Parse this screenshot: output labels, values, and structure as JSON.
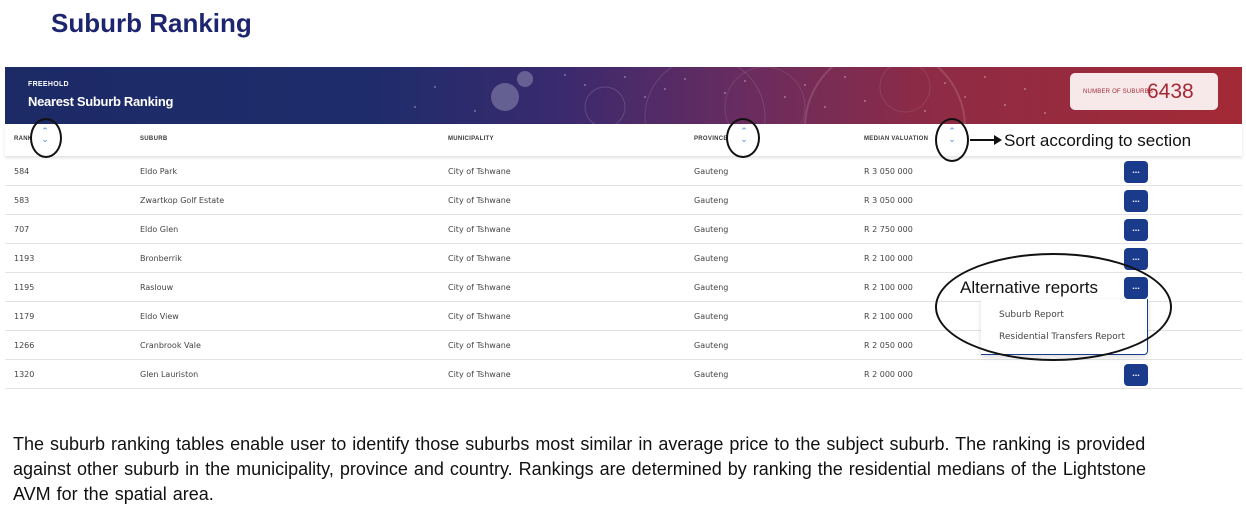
{
  "slide": {
    "title": "Suburb Ranking",
    "description": "The suburb ranking tables enable user to identify those suburbs most similar in average price to the subject suburb. The ranking is provided against other suburb in the municipality, province and country. Rankings are determined by ranking the residential medians of the Lightstone AVM for the spatial area."
  },
  "banner": {
    "subtitle": "FREEHOLD",
    "title": "Nearest Suburb Ranking",
    "count_label": "NUMBER OF SUBURBS",
    "count_value": "6438"
  },
  "columns": {
    "rank": "RANK",
    "suburb": "SUBURB",
    "municipality": "MUNICIPALITY",
    "province": "PROVINCE",
    "median": "MEDIAN VALUATION"
  },
  "rows": [
    {
      "rank": "584",
      "suburb": "Eldo Park",
      "municipality": "City of Tshwane",
      "province": "Gauteng",
      "median": "R 3 050 000",
      "action": "..."
    },
    {
      "rank": "583",
      "suburb": "Zwartkop Golf Estate",
      "municipality": "City of Tshwane",
      "province": "Gauteng",
      "median": "R 3 050 000",
      "action": "..."
    },
    {
      "rank": "707",
      "suburb": "Eldo Glen",
      "municipality": "City of Tshwane",
      "province": "Gauteng",
      "median": "R 2 750 000",
      "action": "..."
    },
    {
      "rank": "1193",
      "suburb": "Bronberrik",
      "municipality": "City of Tshwane",
      "province": "Gauteng",
      "median": "R 2 100 000",
      "action": "..."
    },
    {
      "rank": "1195",
      "suburb": "Raslouw",
      "municipality": "City of Tshwane",
      "province": "Gauteng",
      "median": "R 2 100 000",
      "action": "..."
    },
    {
      "rank": "1179",
      "suburb": "Eldo View",
      "municipality": "City of Tshwane",
      "province": "Gauteng",
      "median": "R 2 100 000",
      "action": "..."
    },
    {
      "rank": "1266",
      "suburb": "Cranbrook Vale",
      "municipality": "City of Tshwane",
      "province": "Gauteng",
      "median": "R 2 050 000",
      "action": "..."
    },
    {
      "rank": "1320",
      "suburb": "Glen Lauriston",
      "municipality": "City of Tshwane",
      "province": "Gauteng",
      "median": "R 2 000 000",
      "action": "..."
    }
  ],
  "dropdown": {
    "items": [
      "Suburb Report",
      "Residential Transfers Report"
    ]
  },
  "callouts": {
    "sort": "Sort according to section",
    "alt": "Alternative reports"
  },
  "colors": {
    "title": "#1d2570",
    "banner_left": "#1c2a66",
    "banner_right": "#a32a35",
    "button": "#1a3a8c",
    "sort_icon": "#4a90d9"
  }
}
